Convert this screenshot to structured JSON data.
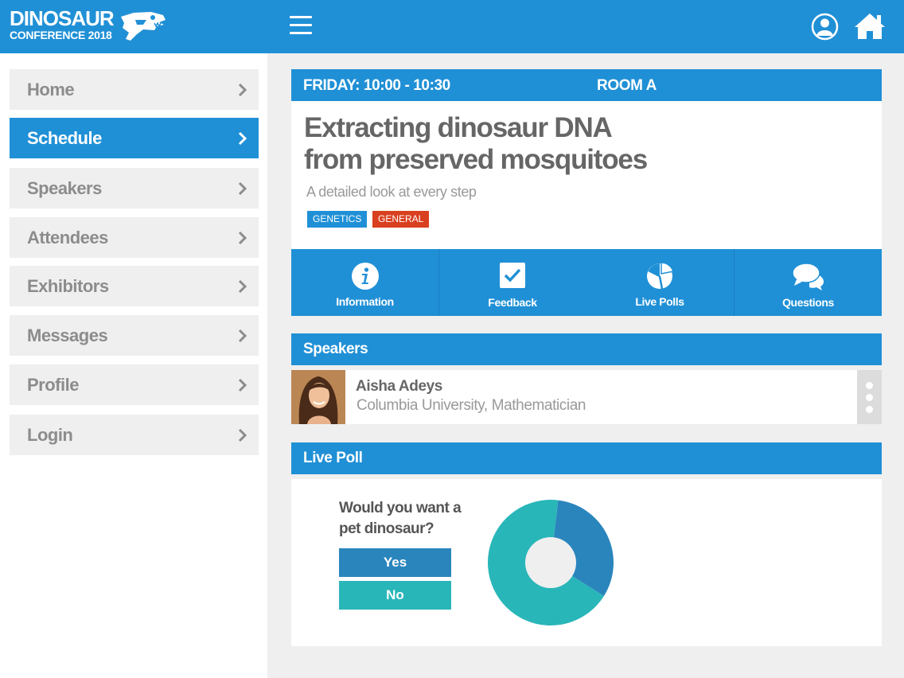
{
  "header": {
    "logo_line1": "DINOSAUR",
    "logo_line2": "CONFERENCE 2018",
    "icons": [
      "dinosaur-skull-icon",
      "hamburger-menu-icon",
      "user-profile-icon",
      "home-icon"
    ]
  },
  "sidebar": {
    "items": [
      {
        "label": "Home",
        "active": false
      },
      {
        "label": "Schedule",
        "active": true
      },
      {
        "label": "Speakers",
        "active": false
      },
      {
        "label": "Attendees",
        "active": false
      },
      {
        "label": "Exhibitors",
        "active": false
      },
      {
        "label": "Messages",
        "active": false
      },
      {
        "label": "Profile",
        "active": false
      },
      {
        "label": "Login",
        "active": false
      }
    ]
  },
  "session": {
    "time": "FRIDAY: 10:00 - 10:30",
    "room": "ROOM A",
    "title_line1": "Extracting dinosaur DNA",
    "title_line2": "from preserved mosquitoes",
    "subtitle": "A detailed look at every step",
    "tags": [
      {
        "label": "GENETICS",
        "color": "#2090d6"
      },
      {
        "label": "GENERAL",
        "color": "#d9401f"
      }
    ]
  },
  "actions": [
    {
      "label": "Information",
      "icon": "info-icon"
    },
    {
      "label": "Feedback",
      "icon": "checkbox-icon"
    },
    {
      "label": "Live Polls",
      "icon": "pie-chart-icon"
    },
    {
      "label": "Questions",
      "icon": "speech-bubbles-icon"
    }
  ],
  "speakers": {
    "heading": "Speakers",
    "list": [
      {
        "name": "Aisha Adeys",
        "affiliation": "Columbia University, Mathematician"
      }
    ]
  },
  "poll": {
    "heading": "Live Poll",
    "question_line1": "Would you want a",
    "question_line2": "pet dinosaur?",
    "options": [
      {
        "label": "Yes",
        "color": "#2a85bd",
        "share": 0.32
      },
      {
        "label": "No",
        "color": "#29b6b9",
        "share": 0.68
      }
    ]
  },
  "colors": {
    "brand_blue": "#2090d6",
    "tag_red": "#d9401f",
    "teal": "#29b6b9",
    "poll_blue": "#2a85bd"
  }
}
